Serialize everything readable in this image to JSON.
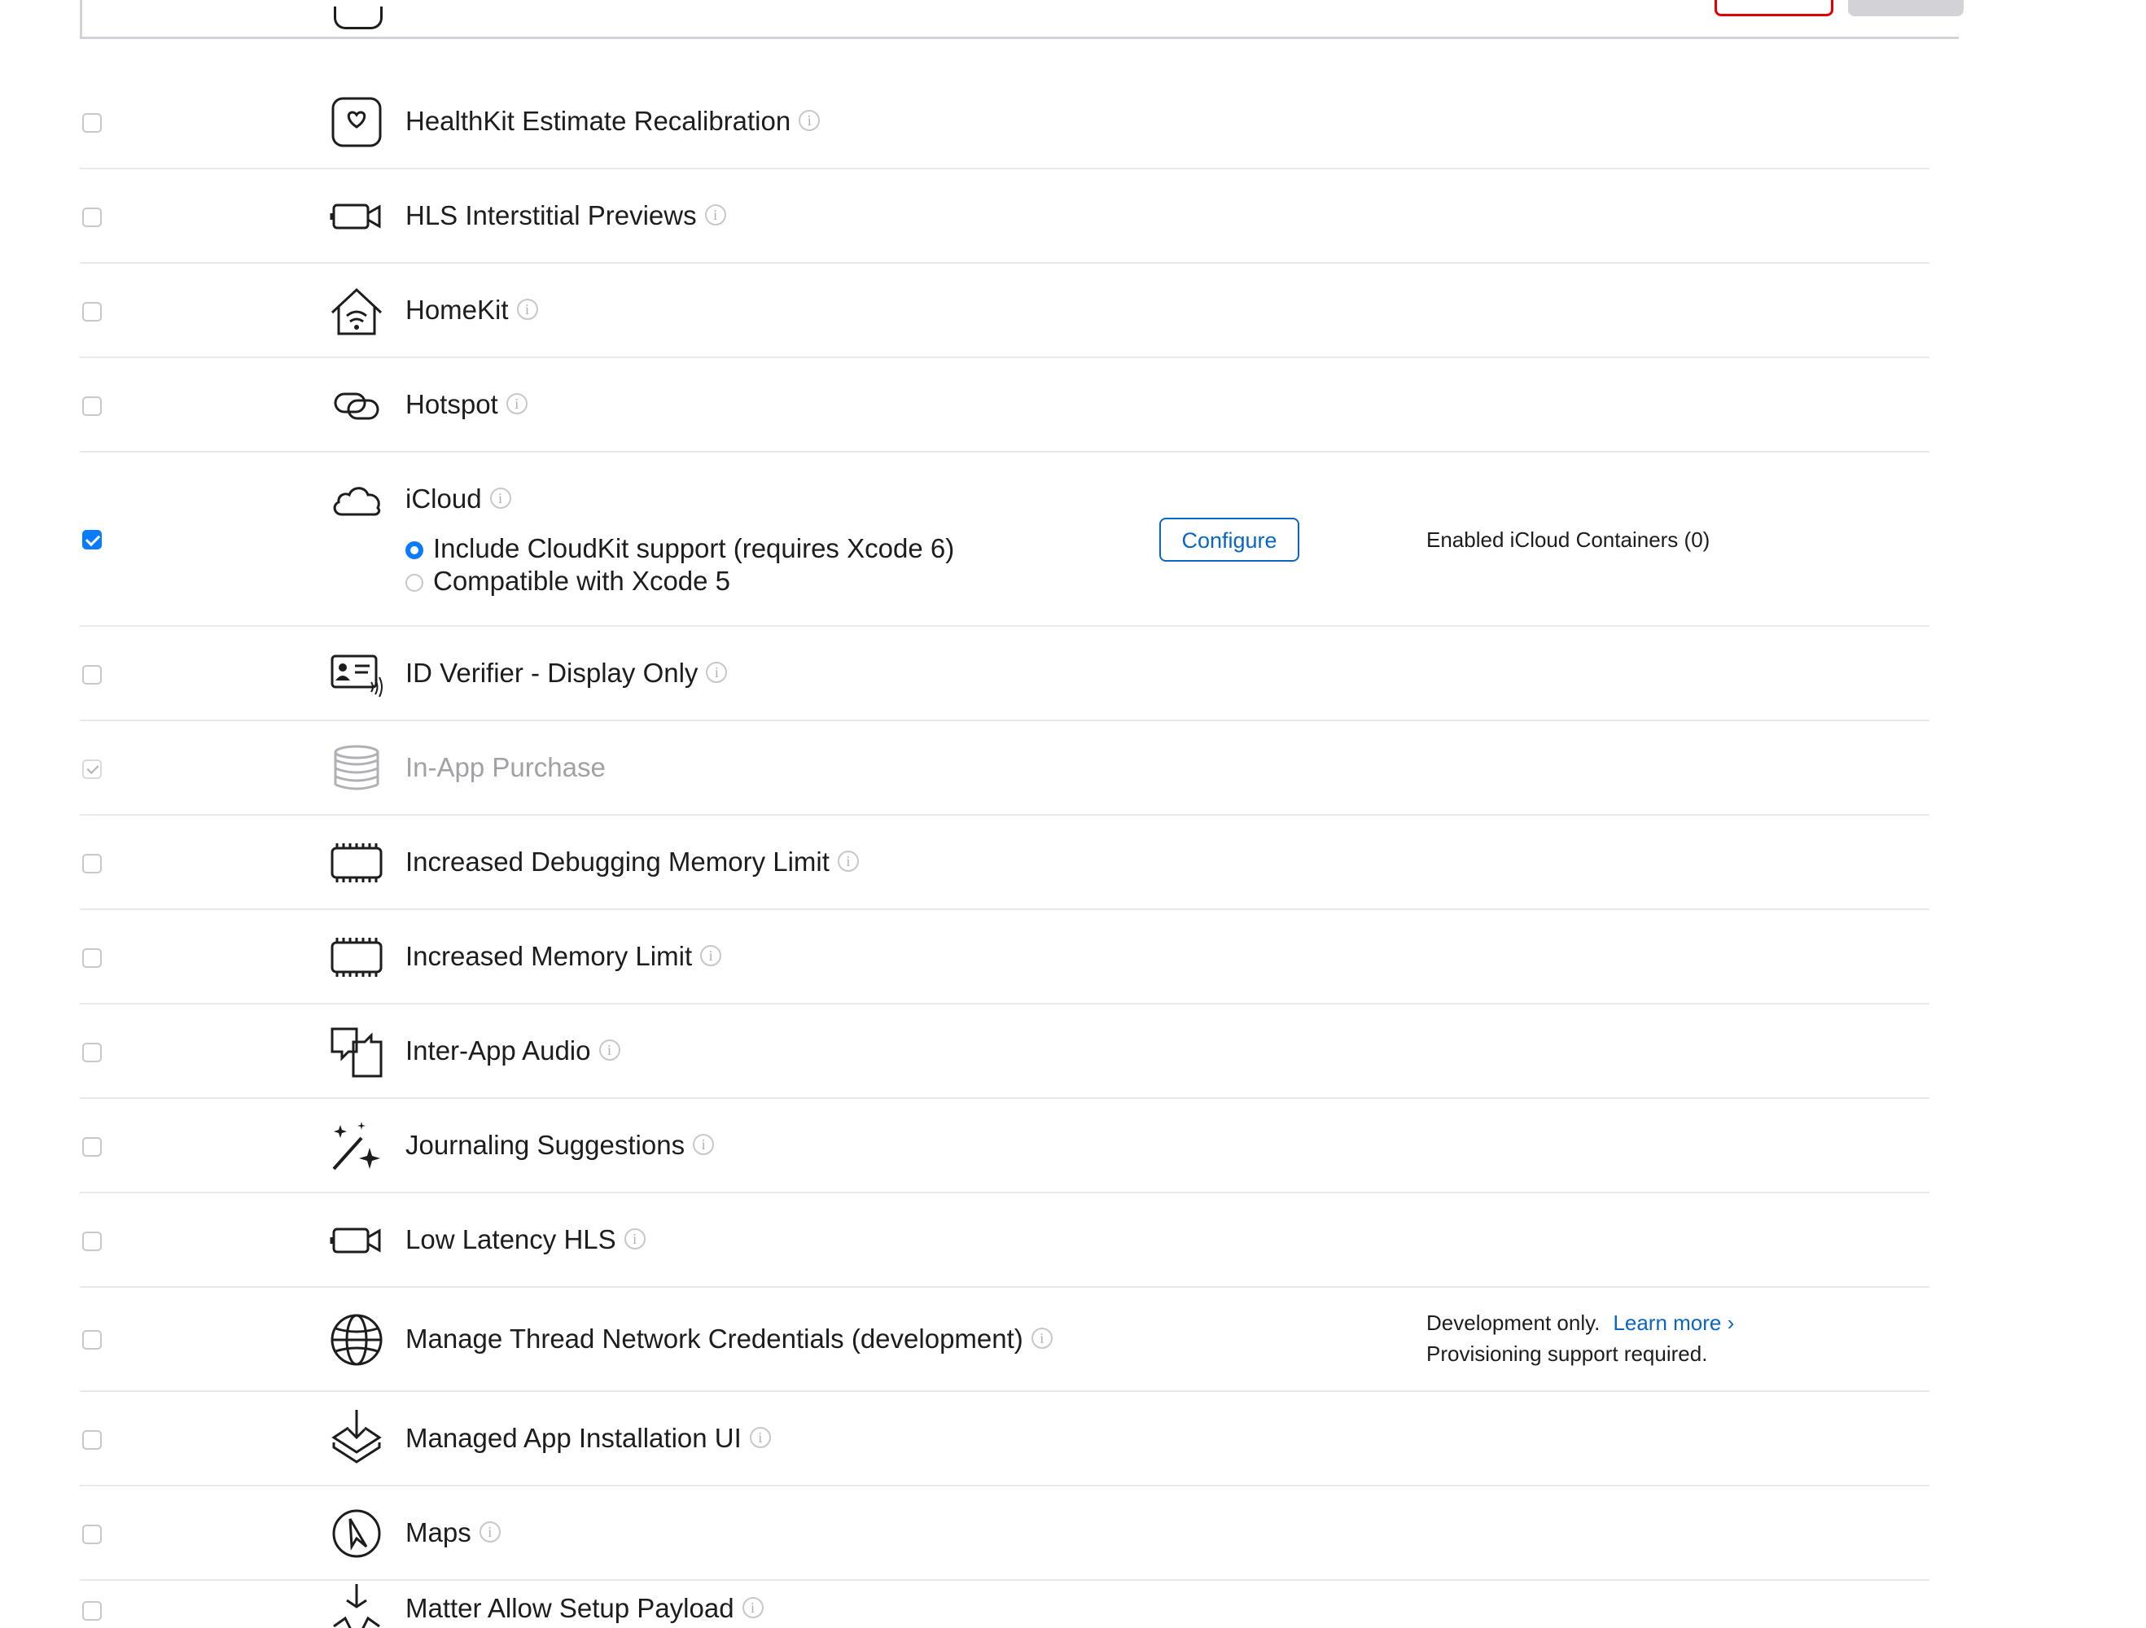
{
  "header": {
    "remove_label": "",
    "save_label": ""
  },
  "capabilities": [
    {
      "name": "HealthKit Estimate Recalibration",
      "checked": false,
      "icon": "heart-square-icon"
    },
    {
      "name": "HLS Interstitial Previews",
      "checked": false,
      "icon": "video-camera-icon"
    },
    {
      "name": "HomeKit",
      "checked": false,
      "icon": "home-icon"
    },
    {
      "name": "Hotspot",
      "checked": false,
      "icon": "hotspot-link-icon"
    },
    {
      "name": "iCloud",
      "checked": true,
      "icon": "cloud-icon",
      "options": [
        "Include CloudKit support (requires Xcode 6)",
        "Compatible with Xcode 5"
      ],
      "selected_option": 0,
      "configure_label": "Configure",
      "side_text": "Enabled iCloud Containers (0)"
    },
    {
      "name": "ID Verifier - Display Only",
      "checked": false,
      "icon": "id-card-icon"
    },
    {
      "name": "In-App Purchase",
      "checked": true,
      "disabled": true,
      "icon": "coins-stack-icon"
    },
    {
      "name": "Increased Debugging Memory Limit",
      "checked": false,
      "icon": "memory-chip-icon"
    },
    {
      "name": "Increased Memory Limit",
      "checked": false,
      "icon": "memory-chip-icon"
    },
    {
      "name": "Inter-App Audio",
      "checked": false,
      "icon": "inter-app-audio-icon"
    },
    {
      "name": "Journaling Suggestions",
      "checked": false,
      "icon": "magic-wand-icon"
    },
    {
      "name": "Low Latency HLS",
      "checked": false,
      "icon": "video-camera-icon"
    },
    {
      "name": "Manage Thread Network Credentials (development)",
      "checked": false,
      "icon": "globe-icon",
      "side_text": "Development only.",
      "side_link": "Learn more ›",
      "side_text2": "Provisioning support required."
    },
    {
      "name": "Managed App Installation UI",
      "checked": false,
      "icon": "install-download-icon"
    },
    {
      "name": "Maps",
      "checked": false,
      "icon": "compass-icon"
    },
    {
      "name": "Matter Allow Setup Payload",
      "checked": false,
      "icon": "matter-icon"
    }
  ],
  "info_glyph": "i"
}
